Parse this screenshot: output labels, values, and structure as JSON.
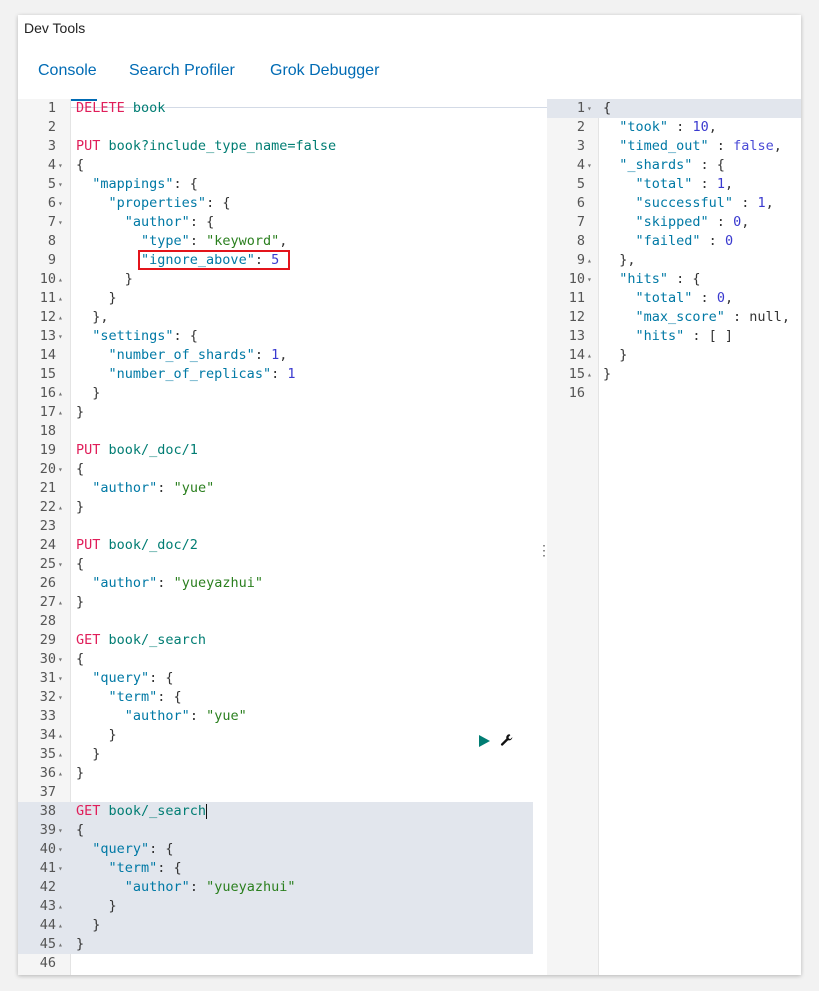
{
  "app": {
    "title": "Dev Tools"
  },
  "tabs": [
    {
      "label": "Console"
    },
    {
      "label": "Search Profiler"
    },
    {
      "label": "Grok Debugger"
    }
  ],
  "request_editor": {
    "lines": [
      [
        {
          "t": "DELETE",
          "c": "kw"
        },
        {
          "t": " "
        },
        {
          "t": "book",
          "c": "path"
        }
      ],
      [],
      [
        {
          "t": "PUT",
          "c": "kw"
        },
        {
          "t": " "
        },
        {
          "t": "book?include_type_name=false",
          "c": "path"
        }
      ],
      [
        {
          "t": "{"
        }
      ],
      [
        {
          "t": "  "
        },
        {
          "t": "\"mappings\"",
          "c": "key"
        },
        {
          "t": ": {"
        }
      ],
      [
        {
          "t": "    "
        },
        {
          "t": "\"properties\"",
          "c": "key"
        },
        {
          "t": ": {"
        }
      ],
      [
        {
          "t": "      "
        },
        {
          "t": "\"author\"",
          "c": "key"
        },
        {
          "t": ": {"
        }
      ],
      [
        {
          "t": "        "
        },
        {
          "t": "\"type\"",
          "c": "key"
        },
        {
          "t": ": "
        },
        {
          "t": "\"keyword\"",
          "c": "str"
        },
        {
          "t": ","
        }
      ],
      [
        {
          "t": "        "
        },
        {
          "t": "\"ignore_above\"",
          "c": "key"
        },
        {
          "t": ": "
        },
        {
          "t": "5",
          "c": "num"
        }
      ],
      [
        {
          "t": "      }"
        }
      ],
      [
        {
          "t": "    }"
        }
      ],
      [
        {
          "t": "  },"
        }
      ],
      [
        {
          "t": "  "
        },
        {
          "t": "\"settings\"",
          "c": "key"
        },
        {
          "t": ": {"
        }
      ],
      [
        {
          "t": "    "
        },
        {
          "t": "\"number_of_shards\"",
          "c": "key"
        },
        {
          "t": ": "
        },
        {
          "t": "1",
          "c": "num"
        },
        {
          "t": ","
        }
      ],
      [
        {
          "t": "    "
        },
        {
          "t": "\"number_of_replicas\"",
          "c": "key"
        },
        {
          "t": ": "
        },
        {
          "t": "1",
          "c": "num"
        }
      ],
      [
        {
          "t": "  }"
        }
      ],
      [
        {
          "t": "}"
        }
      ],
      [],
      [
        {
          "t": "PUT",
          "c": "kw"
        },
        {
          "t": " "
        },
        {
          "t": "book/_doc/1",
          "c": "path"
        }
      ],
      [
        {
          "t": "{"
        }
      ],
      [
        {
          "t": "  "
        },
        {
          "t": "\"author\"",
          "c": "key"
        },
        {
          "t": ": "
        },
        {
          "t": "\"yue\"",
          "c": "str"
        }
      ],
      [
        {
          "t": "}"
        }
      ],
      [],
      [
        {
          "t": "PUT",
          "c": "kw"
        },
        {
          "t": " "
        },
        {
          "t": "book/_doc/2",
          "c": "path"
        }
      ],
      [
        {
          "t": "{"
        }
      ],
      [
        {
          "t": "  "
        },
        {
          "t": "\"author\"",
          "c": "key"
        },
        {
          "t": ": "
        },
        {
          "t": "\"yueyazhui\"",
          "c": "str"
        }
      ],
      [
        {
          "t": "}"
        }
      ],
      [],
      [
        {
          "t": "GET",
          "c": "kw"
        },
        {
          "t": " "
        },
        {
          "t": "book/_search",
          "c": "path"
        }
      ],
      [
        {
          "t": "{"
        }
      ],
      [
        {
          "t": "  "
        },
        {
          "t": "\"query\"",
          "c": "key"
        },
        {
          "t": ": {"
        }
      ],
      [
        {
          "t": "    "
        },
        {
          "t": "\"term\"",
          "c": "key"
        },
        {
          "t": ": {"
        }
      ],
      [
        {
          "t": "      "
        },
        {
          "t": "\"author\"",
          "c": "key"
        },
        {
          "t": ": "
        },
        {
          "t": "\"yue\"",
          "c": "str"
        }
      ],
      [
        {
          "t": "    }"
        }
      ],
      [
        {
          "t": "  }"
        }
      ],
      [
        {
          "t": "}"
        }
      ],
      [],
      [
        {
          "t": "GET",
          "c": "kw"
        },
        {
          "t": " "
        },
        {
          "t": "book/_search",
          "c": "path"
        }
      ],
      [
        {
          "t": "{"
        }
      ],
      [
        {
          "t": "  "
        },
        {
          "t": "\"query\"",
          "c": "key"
        },
        {
          "t": ": {"
        }
      ],
      [
        {
          "t": "    "
        },
        {
          "t": "\"term\"",
          "c": "key"
        },
        {
          "t": ": {"
        }
      ],
      [
        {
          "t": "      "
        },
        {
          "t": "\"author\"",
          "c": "key"
        },
        {
          "t": ": "
        },
        {
          "t": "\"yueyazhui\"",
          "c": "str"
        }
      ],
      [
        {
          "t": "    }"
        }
      ],
      [
        {
          "t": "  }"
        }
      ],
      [
        {
          "t": "}"
        }
      ],
      []
    ],
    "folds": {
      "4": "open",
      "5": "open",
      "6": "open",
      "7": "open",
      "10": "close",
      "11": "close",
      "12": "close",
      "13": "open",
      "16": "close",
      "17": "close",
      "20": "open",
      "22": "close",
      "25": "open",
      "27": "close",
      "30": "open",
      "31": "open",
      "32": "open",
      "34": "close",
      "35": "close",
      "36": "close",
      "39": "open",
      "40": "open",
      "41": "open",
      "43": "close",
      "44": "close",
      "45": "close"
    },
    "highlighted_lines": [
      38,
      39,
      40,
      41,
      42,
      43,
      44,
      45
    ],
    "cursor_line": 38
  },
  "response_editor": {
    "lines": [
      [
        {
          "t": "{"
        }
      ],
      [
        {
          "t": "  "
        },
        {
          "t": "\"took\"",
          "c": "key"
        },
        {
          "t": " : "
        },
        {
          "t": "10",
          "c": "num"
        },
        {
          "t": ","
        }
      ],
      [
        {
          "t": "  "
        },
        {
          "t": "\"timed_out\"",
          "c": "key"
        },
        {
          "t": " : "
        },
        {
          "t": "false",
          "c": "bool"
        },
        {
          "t": ","
        }
      ],
      [
        {
          "t": "  "
        },
        {
          "t": "\"_shards\"",
          "c": "key"
        },
        {
          "t": " : {"
        }
      ],
      [
        {
          "t": "    "
        },
        {
          "t": "\"total\"",
          "c": "key"
        },
        {
          "t": " : "
        },
        {
          "t": "1",
          "c": "num"
        },
        {
          "t": ","
        }
      ],
      [
        {
          "t": "    "
        },
        {
          "t": "\"successful\"",
          "c": "key"
        },
        {
          "t": " : "
        },
        {
          "t": "1",
          "c": "num"
        },
        {
          "t": ","
        }
      ],
      [
        {
          "t": "    "
        },
        {
          "t": "\"skipped\"",
          "c": "key"
        },
        {
          "t": " : "
        },
        {
          "t": "0",
          "c": "num"
        },
        {
          "t": ","
        }
      ],
      [
        {
          "t": "    "
        },
        {
          "t": "\"failed\"",
          "c": "key"
        },
        {
          "t": " : "
        },
        {
          "t": "0",
          "c": "num"
        }
      ],
      [
        {
          "t": "  },"
        }
      ],
      [
        {
          "t": "  "
        },
        {
          "t": "\"hits\"",
          "c": "key"
        },
        {
          "t": " : {"
        }
      ],
      [
        {
          "t": "    "
        },
        {
          "t": "\"total\"",
          "c": "key"
        },
        {
          "t": " : "
        },
        {
          "t": "0",
          "c": "num"
        },
        {
          "t": ","
        }
      ],
      [
        {
          "t": "    "
        },
        {
          "t": "\"max_score\"",
          "c": "key"
        },
        {
          "t": " : null,"
        }
      ],
      [
        {
          "t": "    "
        },
        {
          "t": "\"hits\"",
          "c": "key"
        },
        {
          "t": " : [ ]"
        }
      ],
      [
        {
          "t": "  }"
        }
      ],
      [
        {
          "t": "}"
        }
      ],
      []
    ],
    "folds": {
      "1": "open",
      "4": "open",
      "9": "close",
      "10": "open",
      "14": "close",
      "15": "close"
    },
    "highlighted_lines": [
      1
    ]
  },
  "toolbar": {
    "run_icon": "play-icon",
    "settings_icon": "wrench-icon"
  },
  "colors": {
    "accent": "#006bb4",
    "keyword": "#e01e5a",
    "path": "#017d73",
    "annotation": "#e3141b"
  }
}
